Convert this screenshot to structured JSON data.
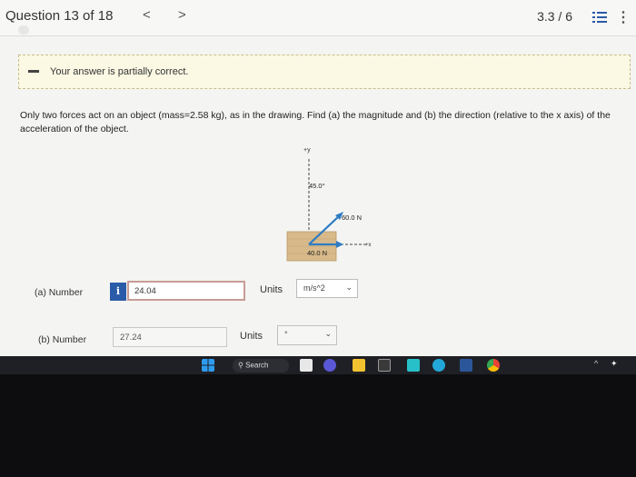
{
  "header": {
    "question_title": "Question 13 of 18",
    "prev_glyph": "<",
    "next_glyph": ">",
    "score": "3.3 / 6",
    "more_glyph": "⋮"
  },
  "banner": {
    "text": "Your answer is partially correct."
  },
  "question": {
    "text": "Only two forces act on an object (mass=2.58 kg), as in the drawing. Find (a) the magnitude and (b) the direction (relative to the x axis) of the acceleration of the object."
  },
  "figure": {
    "y_axis_label": "+y",
    "x_axis_label": "+x",
    "angle_label": "45.0°",
    "force1_label": "60.0 N",
    "force2_label": "40.0 N",
    "colors": {
      "arrow": "#2e7cc4",
      "block": "#d8b98a"
    }
  },
  "part_a": {
    "label": "(a)   Number",
    "info_glyph": "i",
    "value": "24.04",
    "units_label": "Units",
    "units_value": "m/s^2"
  },
  "part_b": {
    "label": "(b)   Number",
    "value": "27.24",
    "units_label": "Units",
    "units_value": "°"
  },
  "taskbar": {
    "search_label": "Search",
    "icons": [
      "windows-icon",
      "search-icon",
      "file-explorer-icon",
      "video-icon",
      "folder-icon",
      "store-icon",
      "app-icon",
      "edge-icon",
      "word-icon",
      "chrome-icon"
    ],
    "tray_chevron": "^"
  }
}
